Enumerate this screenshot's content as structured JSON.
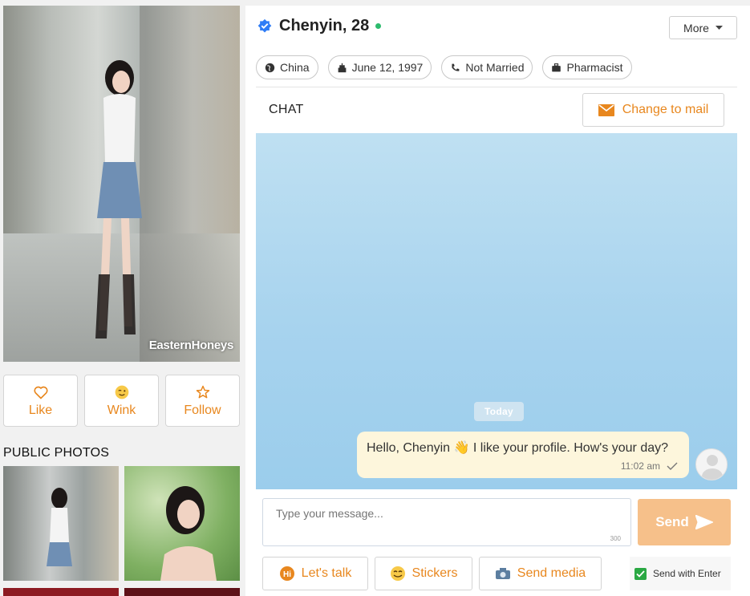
{
  "profile": {
    "name": "Chenyin, 28",
    "watermark": "EasternHoneys",
    "more_label": "More",
    "chips": [
      {
        "icon": "globe-icon",
        "label": "China"
      },
      {
        "icon": "cake-icon",
        "label": "June 12, 1997"
      },
      {
        "icon": "ring-icon",
        "label": "Not Married"
      },
      {
        "icon": "briefcase-icon",
        "label": "Pharmacist"
      }
    ]
  },
  "actions": {
    "like": "Like",
    "wink": "Wink",
    "follow": "Follow"
  },
  "public_photos": {
    "title": "PUBLIC PHOTOS"
  },
  "chat": {
    "title": "CHAT",
    "change_to_mail": "Change to mail",
    "date_divider": "Today",
    "messages": [
      {
        "text": "Hello, Chenyin 👋 I like your profile. How's your day?",
        "time": "11:02 am"
      }
    ],
    "input_placeholder": "Type your message...",
    "char_counter": "300",
    "send_label": "Send",
    "lets_talk": "Let's talk",
    "stickers": "Stickers",
    "send_media": "Send media",
    "send_with_enter": "Send with Enter"
  },
  "colors": {
    "accent": "#e8871e",
    "online": "#2dbb6d",
    "verified": "#2e7cf6",
    "send_button": "#f6c08a"
  }
}
